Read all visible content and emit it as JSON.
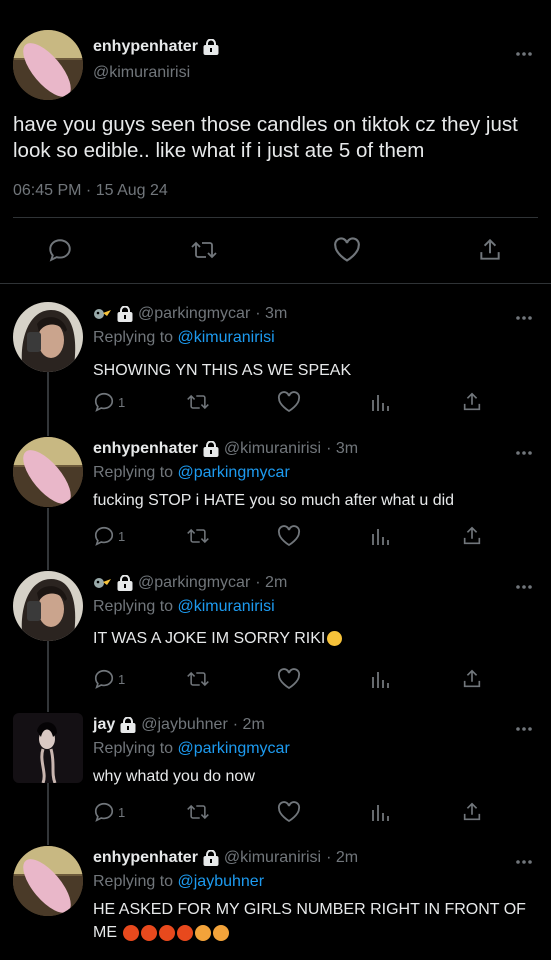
{
  "main_tweet": {
    "name": "enhypenhater",
    "handle": "@kimuranirisi",
    "text": "have you guys seen those candles on tiktok cz they just look so edible.. like what if i just ate 5 of them",
    "timestamp": "06:45 PM · 15 Aug 24",
    "icons": [
      "reply-icon",
      "retweet-icon",
      "like-icon",
      "share-icon"
    ]
  },
  "replies": [
    {
      "name": "",
      "handle": "@parkingmycar",
      "time": "· 3m",
      "replying_label": "Replying to",
      "replying_to": "@kimuranirisi",
      "text": "SHOWING YN THIS AS WE SPEAK",
      "reply_count": "1"
    },
    {
      "name": "enhypenhater",
      "handle": "@kimuranirisi",
      "time": "· 3m",
      "replying_label": "Replying to",
      "replying_to": "@parkingmycar",
      "text": "fucking STOP i HATE you so much after what u did",
      "reply_count": "1"
    },
    {
      "name": "",
      "handle": "@parkingmycar",
      "time": "· 2m",
      "replying_label": "Replying to",
      "replying_to": "@kimuranirisi",
      "text": "IT WAS A JOKE IM SORRY RIKI",
      "reply_count": "1"
    },
    {
      "name": "jay",
      "handle": "@jaybuhner",
      "time": "· 2m",
      "replying_label": "Replying to",
      "replying_to": "@parkingmycar",
      "text": "why whatd you do now",
      "reply_count": "1"
    },
    {
      "name": "enhypenhater",
      "handle": "@kimuranirisi",
      "time": "· 2m",
      "replying_label": "Replying to",
      "replying_to": "@jaybuhner",
      "text": "HE ASKED FOR MY GIRLS NUMBER RIGHT IN FRONT OF ME",
      "reply_count": ""
    }
  ],
  "colors": {
    "background": "#000000",
    "text": "#e7e9ea",
    "muted": "#71767b",
    "link": "#1d9bf0",
    "divider": "#2f3336"
  }
}
